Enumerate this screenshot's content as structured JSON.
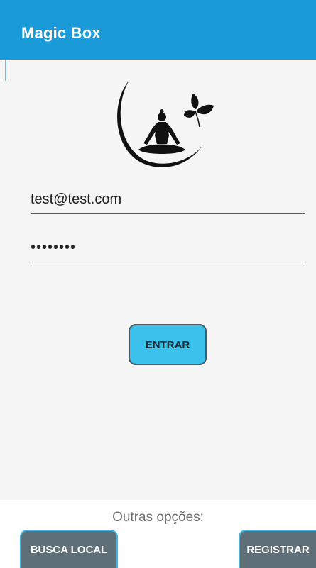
{
  "app_bar": {
    "title": "Magic Box",
    "color": "#1a9ad9"
  },
  "logo": {
    "icon": "meditation-logo-icon"
  },
  "login": {
    "email_value": "test@test.com",
    "password_value": "••••••••",
    "enter_label": "ENTRAR",
    "button_color": "#3bc2ec"
  },
  "footer": {
    "other_options_label": "Outras opções:",
    "local_search_label": "BUSCA LOCAL",
    "register_label": "REGISTRAR",
    "button_color": "#5e6f78"
  }
}
